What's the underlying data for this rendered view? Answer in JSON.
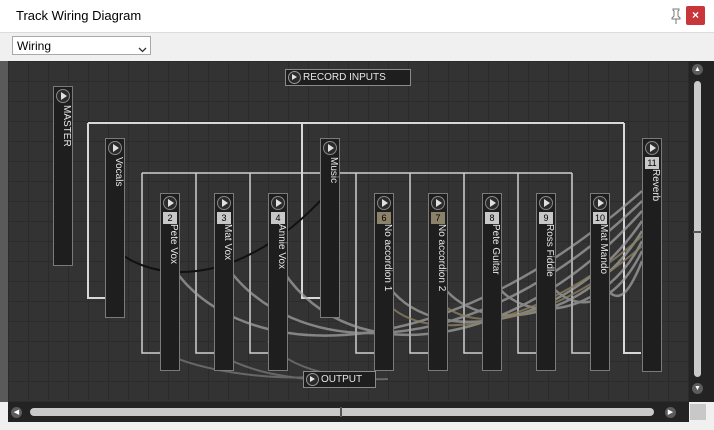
{
  "window": {
    "title": "Track Wiring Diagram",
    "pin_icon": "pin-icon",
    "close_label": "×"
  },
  "toolbar": {
    "view_select": {
      "value": "Wiring"
    }
  },
  "canvas": {
    "record_inputs_label": "RECORD INPUTS",
    "output_label": "OUTPUT",
    "tracks": [
      {
        "key": "master",
        "name": "MASTER",
        "number": ""
      },
      {
        "key": "vocals",
        "name": "Vocals",
        "number": ""
      },
      {
        "key": "pete-vox",
        "name": "Pete Vox",
        "number": "2"
      },
      {
        "key": "mat-vox",
        "name": "Mat Vox",
        "number": "3"
      },
      {
        "key": "annie-vox",
        "name": "Annie Vox",
        "number": "4"
      },
      {
        "key": "music",
        "name": "Music",
        "number": ""
      },
      {
        "key": "no-accordion-1",
        "name": "No accordion 1",
        "number": "6"
      },
      {
        "key": "no-accordion-2",
        "name": "No accordion 2",
        "number": "7"
      },
      {
        "key": "pete-guitar",
        "name": "Pete Guitar",
        "number": "8"
      },
      {
        "key": "ross-fiddle",
        "name": "Ross Fiddle",
        "number": "9"
      },
      {
        "key": "mat-mando",
        "name": "Mat Mando",
        "number": "10"
      },
      {
        "key": "reverb",
        "name": "Reverb",
        "number": "11"
      }
    ]
  },
  "colors": {
    "canvas_bg": "#333333",
    "close_bg": "#c8363c",
    "wire": "#a0a0a0",
    "muted_number": "#8c826a"
  }
}
